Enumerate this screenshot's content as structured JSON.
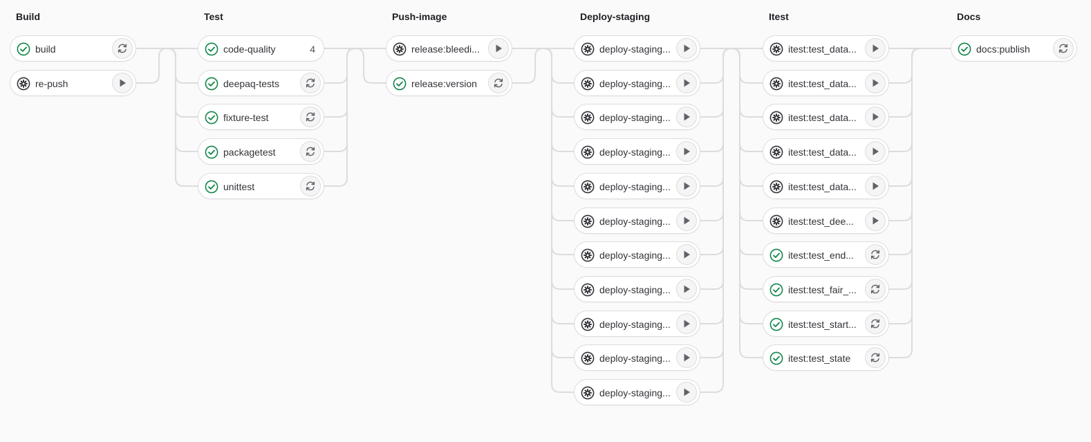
{
  "colors": {
    "success": "#108548",
    "manual": "#333238",
    "connector": "#dcdcde",
    "action_icon": "#626168"
  },
  "stages": [
    {
      "title": "Build",
      "jobs": [
        {
          "name": "build",
          "status": "success",
          "status_icon": "check-circle-icon",
          "action": "retry",
          "action_icon": "retry-icon"
        },
        {
          "name": "re-push",
          "status": "manual",
          "status_icon": "gear-icon",
          "action": "play",
          "action_icon": "play-icon"
        }
      ]
    },
    {
      "title": "Test",
      "jobs": [
        {
          "name": "code-quality",
          "status": "success",
          "status_icon": "check-circle-icon",
          "count": "4"
        },
        {
          "name": "deepaq-tests",
          "status": "success",
          "status_icon": "check-circle-icon",
          "action": "retry",
          "action_icon": "retry-icon"
        },
        {
          "name": "fixture-test",
          "status": "success",
          "status_icon": "check-circle-icon",
          "action": "retry",
          "action_icon": "retry-icon"
        },
        {
          "name": "packagetest",
          "status": "success",
          "status_icon": "check-circle-icon",
          "action": "retry",
          "action_icon": "retry-icon"
        },
        {
          "name": "unittest",
          "status": "success",
          "status_icon": "check-circle-icon",
          "action": "retry",
          "action_icon": "retry-icon"
        }
      ]
    },
    {
      "title": "Push-image",
      "jobs": [
        {
          "name": "release:bleedi...",
          "status": "manual",
          "status_icon": "gear-icon",
          "action": "play",
          "action_icon": "play-icon"
        },
        {
          "name": "release:version",
          "status": "success",
          "status_icon": "check-circle-icon",
          "action": "retry",
          "action_icon": "retry-icon"
        }
      ]
    },
    {
      "title": "Deploy-staging",
      "jobs": [
        {
          "name": "deploy-staging...",
          "status": "manual",
          "status_icon": "gear-icon",
          "action": "play",
          "action_icon": "play-icon"
        },
        {
          "name": "deploy-staging...",
          "status": "manual",
          "status_icon": "gear-icon",
          "action": "play",
          "action_icon": "play-icon"
        },
        {
          "name": "deploy-staging...",
          "status": "manual",
          "status_icon": "gear-icon",
          "action": "play",
          "action_icon": "play-icon"
        },
        {
          "name": "deploy-staging...",
          "status": "manual",
          "status_icon": "gear-icon",
          "action": "play",
          "action_icon": "play-icon"
        },
        {
          "name": "deploy-staging...",
          "status": "manual",
          "status_icon": "gear-icon",
          "action": "play",
          "action_icon": "play-icon"
        },
        {
          "name": "deploy-staging...",
          "status": "manual",
          "status_icon": "gear-icon",
          "action": "play",
          "action_icon": "play-icon"
        },
        {
          "name": "deploy-staging...",
          "status": "manual",
          "status_icon": "gear-icon",
          "action": "play",
          "action_icon": "play-icon"
        },
        {
          "name": "deploy-staging...",
          "status": "manual",
          "status_icon": "gear-icon",
          "action": "play",
          "action_icon": "play-icon"
        },
        {
          "name": "deploy-staging...",
          "status": "manual",
          "status_icon": "gear-icon",
          "action": "play",
          "action_icon": "play-icon"
        },
        {
          "name": "deploy-staging...",
          "status": "manual",
          "status_icon": "gear-icon",
          "action": "play",
          "action_icon": "play-icon"
        },
        {
          "name": "deploy-staging...",
          "status": "manual",
          "status_icon": "gear-icon",
          "action": "play",
          "action_icon": "play-icon"
        }
      ]
    },
    {
      "title": "Itest",
      "jobs": [
        {
          "name": "itest:test_data...",
          "status": "manual",
          "status_icon": "gear-icon",
          "action": "play",
          "action_icon": "play-icon"
        },
        {
          "name": "itest:test_data...",
          "status": "manual",
          "status_icon": "gear-icon",
          "action": "play",
          "action_icon": "play-icon"
        },
        {
          "name": "itest:test_data...",
          "status": "manual",
          "status_icon": "gear-icon",
          "action": "play",
          "action_icon": "play-icon"
        },
        {
          "name": "itest:test_data...",
          "status": "manual",
          "status_icon": "gear-icon",
          "action": "play",
          "action_icon": "play-icon"
        },
        {
          "name": "itest:test_data...",
          "status": "manual",
          "status_icon": "gear-icon",
          "action": "play",
          "action_icon": "play-icon"
        },
        {
          "name": "itest:test_dee...",
          "status": "manual",
          "status_icon": "gear-icon",
          "action": "play",
          "action_icon": "play-icon"
        },
        {
          "name": "itest:test_end...",
          "status": "success",
          "status_icon": "check-circle-icon",
          "action": "retry",
          "action_icon": "retry-icon"
        },
        {
          "name": "itest:test_fair_...",
          "status": "success",
          "status_icon": "check-circle-icon",
          "action": "retry",
          "action_icon": "retry-icon"
        },
        {
          "name": "itest:test_start...",
          "status": "success",
          "status_icon": "check-circle-icon",
          "action": "retry",
          "action_icon": "retry-icon"
        },
        {
          "name": "itest:test_state",
          "status": "success",
          "status_icon": "check-circle-icon",
          "action": "retry",
          "action_icon": "retry-icon"
        }
      ]
    },
    {
      "title": "Docs",
      "jobs": [
        {
          "name": "docs:publish",
          "status": "success",
          "status_icon": "check-circle-icon",
          "action": "retry",
          "action_icon": "retry-icon"
        }
      ]
    }
  ]
}
